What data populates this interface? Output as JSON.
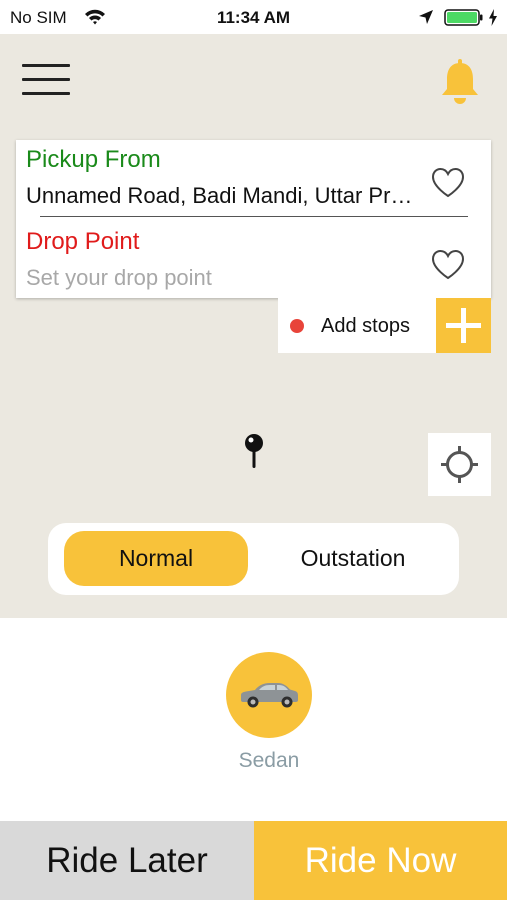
{
  "status_bar": {
    "carrier": "No SIM",
    "time": "11:34 AM",
    "battery_color": "#4cd964"
  },
  "header": {
    "menu_icon": "hamburger-menu-icon",
    "notification_icon": "bell-icon",
    "accent_color": "#f8c23a"
  },
  "address_card": {
    "pickup": {
      "title": "Pickup From",
      "value": "Unnamed Road, Badi Mandi, Uttar Pradesh",
      "title_color": "#1a8a1a"
    },
    "drop": {
      "title": "Drop Point",
      "value": "",
      "placeholder": "Set your drop point",
      "title_color": "#e01b1b"
    },
    "favorite_icon": "heart-outline-icon"
  },
  "add_stops": {
    "label": "Add stops",
    "icon": "plus-icon"
  },
  "map": {
    "pin_icon": "map-pin-icon",
    "locate_icon": "crosshair-locate-icon"
  },
  "trip_type": {
    "options": [
      "Normal",
      "Outstation"
    ],
    "selected": "Normal"
  },
  "vehicle": {
    "label": "Sedan",
    "icon": "sedan-car-icon"
  },
  "actions": {
    "ride_later": "Ride Later",
    "ride_now": "Ride Now"
  }
}
